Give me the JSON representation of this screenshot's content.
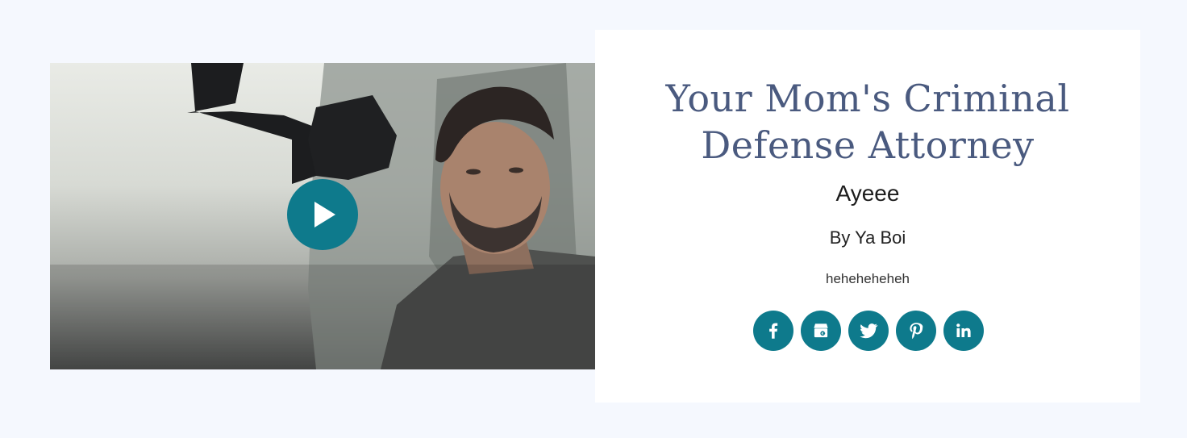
{
  "video": {
    "thumbnail_icon": "video-thumbnail",
    "play_icon": "play-icon"
  },
  "card": {
    "title_line1": "Your Mom's Criminal",
    "title_line2": "Defense Attorney",
    "subtitle": "Ayeee",
    "byline": "By Ya Boi",
    "blurb": "heheheheheh"
  },
  "social": {
    "icons": [
      "facebook-icon",
      "google-my-business-icon",
      "twitter-icon",
      "pinterest-icon",
      "linkedin-icon"
    ]
  },
  "colors": {
    "page_bg": "#f5f8fe",
    "accent": "#0e7a8c",
    "title": "#4a5a7f"
  }
}
